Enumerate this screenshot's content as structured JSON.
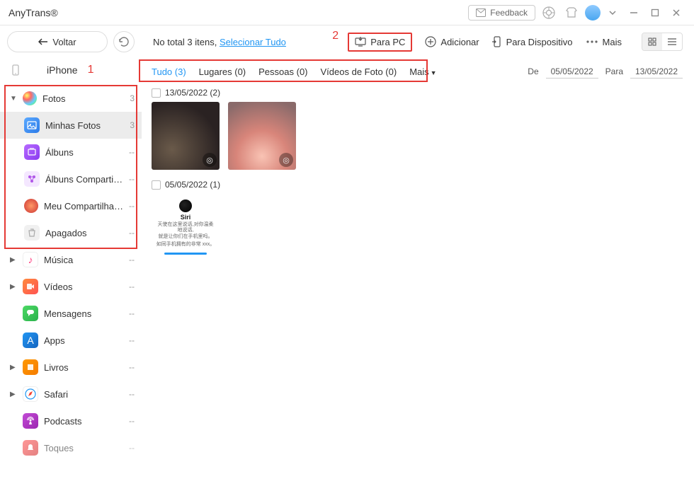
{
  "app": {
    "title": "AnyTrans®"
  },
  "titlebar": {
    "feedback": "Feedback"
  },
  "sidebarHead": {
    "back": "Voltar"
  },
  "device": {
    "name": "iPhone"
  },
  "annotations": {
    "one": "1",
    "two": "2"
  },
  "toolbar": {
    "total_prefix": "No total ",
    "total_count": "3",
    "total_suffix": " itens, ",
    "select_all": "Selecionar Tudo",
    "para_pc": "Para PC",
    "adicionar": "Adicionar",
    "para_dispositivo": "Para Dispositivo",
    "mais": "Mais"
  },
  "filters": {
    "tudo": "Tudo (3)",
    "lugares": "Lugares (0)",
    "pessoas": "Pessoas (0)",
    "videos": "Vídeos de Foto (0)",
    "mais": "Mais",
    "de": "De",
    "para": "Para",
    "date_from": "05/05/2022",
    "date_to": "13/05/2022"
  },
  "groups": {
    "g1_label": "13/05/2022 (2)",
    "g2_label": "05/05/2022 (1)",
    "siri_title": "Siri"
  },
  "sidebar": {
    "fotos": {
      "label": "Fotos",
      "count": "3"
    },
    "minhas": {
      "label": "Minhas Fotos",
      "count": "3"
    },
    "albuns": {
      "label": "Álbuns",
      "count": "--"
    },
    "shared": {
      "label": "Álbuns Compartilhad...",
      "count": "--"
    },
    "meu": {
      "label": "Meu Compartilhame...",
      "count": "--"
    },
    "trash": {
      "label": "Apagados",
      "count": "--"
    },
    "musica": {
      "label": "Música",
      "count": "--"
    },
    "videos": {
      "label": "Vídeos",
      "count": "--"
    },
    "msg": {
      "label": "Mensagens",
      "count": "--"
    },
    "apps": {
      "label": "Apps",
      "count": "--"
    },
    "livros": {
      "label": "Livros",
      "count": "--"
    },
    "safari": {
      "label": "Safari",
      "count": "--"
    },
    "podcasts": {
      "label": "Podcasts",
      "count": "--"
    },
    "toques": {
      "label": "Toques",
      "count": "--"
    }
  }
}
